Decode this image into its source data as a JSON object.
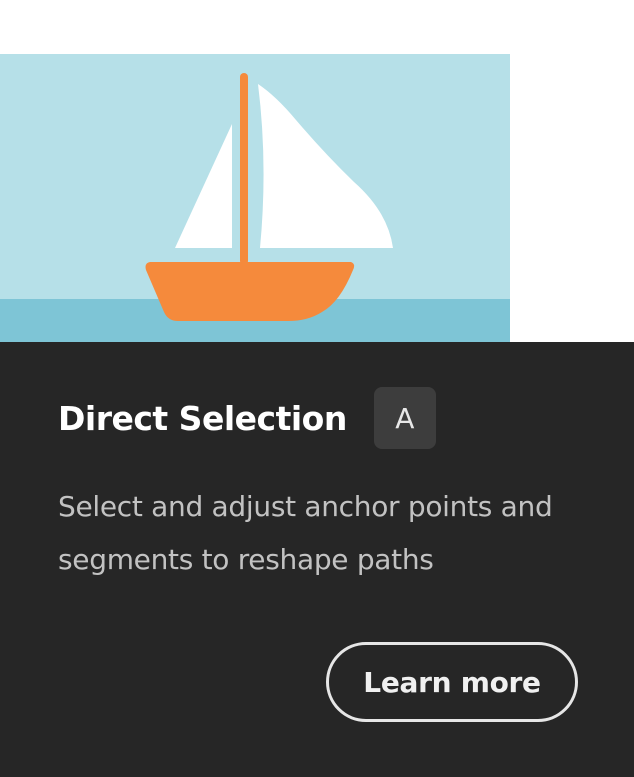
{
  "tooltip": {
    "title": "Direct Selection",
    "shortcut_key": "A",
    "description": "Select and adjust anchor points and segments to reshape paths",
    "learn_more_label": "Learn more"
  },
  "illustration": {
    "name": "sailboat-illustration",
    "colors": {
      "sky": "#b6e0e8",
      "water": "#7ec5d6",
      "sails": "#ffffff",
      "mast": "#f58a3c",
      "hull": "#f58a3c"
    }
  },
  "colors": {
    "panel_background": "#262626",
    "title": "#ffffff",
    "description": "#c2c2c2",
    "shortcut_badge": "#3d3d3d",
    "button_border": "#e6e6e6"
  }
}
